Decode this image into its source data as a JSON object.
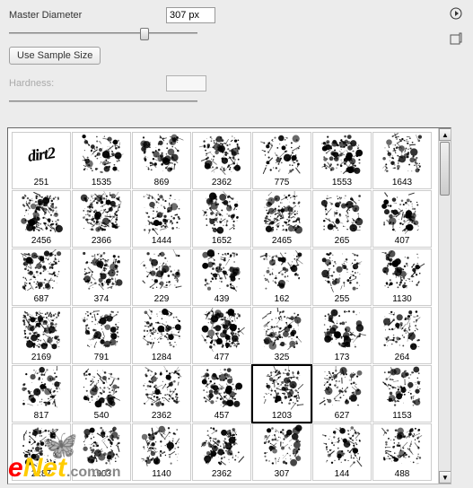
{
  "controls": {
    "master_diameter_label": "Master Diameter",
    "master_diameter_value": "307 px",
    "slider_position_pct": 72,
    "sample_button_label": "Use Sample Size",
    "hardness_label": "Hardness:"
  },
  "brushes": {
    "selected_index": 32,
    "items": [
      {
        "size": "251",
        "kind": "logo",
        "label": "dirt2"
      },
      {
        "size": "1535",
        "dense": 0.34
      },
      {
        "size": "869",
        "dense": 0.28
      },
      {
        "size": "2362",
        "dense": 0.5
      },
      {
        "size": "775",
        "dense": 0.26
      },
      {
        "size": "1553",
        "dense": 0.42
      },
      {
        "size": "1643",
        "dense": 0.3
      },
      {
        "size": "2456",
        "dense": 0.74
      },
      {
        "size": "2366",
        "dense": 0.8
      },
      {
        "size": "1444",
        "dense": 0.38
      },
      {
        "size": "1652",
        "dense": 0.3
      },
      {
        "size": "2465",
        "dense": 0.6
      },
      {
        "size": "265",
        "dense": 0.3
      },
      {
        "size": "407",
        "dense": 0.26
      },
      {
        "size": "687",
        "dense": 0.56
      },
      {
        "size": "374",
        "dense": 0.44
      },
      {
        "size": "229",
        "dense": 0.26
      },
      {
        "size": "439",
        "dense": 0.36
      },
      {
        "size": "162",
        "dense": 0.28
      },
      {
        "size": "255",
        "dense": 0.22
      },
      {
        "size": "1130",
        "dense": 0.34
      },
      {
        "size": "2169",
        "dense": 0.72
      },
      {
        "size": "791",
        "dense": 0.4
      },
      {
        "size": "1284",
        "dense": 0.36
      },
      {
        "size": "477",
        "dense": 0.78
      },
      {
        "size": "325",
        "dense": 0.36
      },
      {
        "size": "173",
        "dense": 0.3
      },
      {
        "size": "264",
        "dense": 0.28
      },
      {
        "size": "817",
        "dense": 0.32
      },
      {
        "size": "540",
        "dense": 0.36
      },
      {
        "size": "2362",
        "dense": 0.44
      },
      {
        "size": "457",
        "dense": 0.34
      },
      {
        "size": "1203",
        "dense": 0.46
      },
      {
        "size": "627",
        "dense": 0.32
      },
      {
        "size": "1153",
        "dense": 0.34
      },
      {
        "size": "2287",
        "dense": 0.4
      },
      {
        "size": "1903",
        "dense": 0.42
      },
      {
        "size": "1140",
        "dense": 0.4
      },
      {
        "size": "2362",
        "dense": 0.44
      },
      {
        "size": "307",
        "dense": 0.28
      },
      {
        "size": "144",
        "dense": 0.32
      },
      {
        "size": "488",
        "dense": 0.36
      }
    ]
  },
  "watermark": {
    "brand_part1": "e",
    "brand_part2": "Net",
    "tail": ".com.cn"
  }
}
